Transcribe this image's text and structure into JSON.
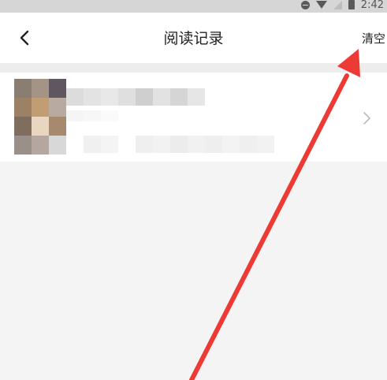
{
  "status_bar": {
    "time": "2:42",
    "icons": [
      "dnd-icon",
      "wifi-icon",
      "signal-icon",
      "battery-icon"
    ]
  },
  "header": {
    "back_icon": "chevron-left-icon",
    "title": "阅读记录",
    "clear_label": "清空"
  },
  "history": {
    "items": [
      {
        "thumbnail": "pixelated-cover-image",
        "title": "",
        "subtitle": "",
        "chevron_icon": "chevron-right-icon"
      }
    ]
  },
  "annotation": {
    "type": "red-arrow",
    "color": "#ee3a34",
    "points_to": "clear-button"
  },
  "colors": {
    "background": "#f4f4f4",
    "card": "#ffffff",
    "text": "#222222",
    "chevron": "#bbbbbb"
  }
}
